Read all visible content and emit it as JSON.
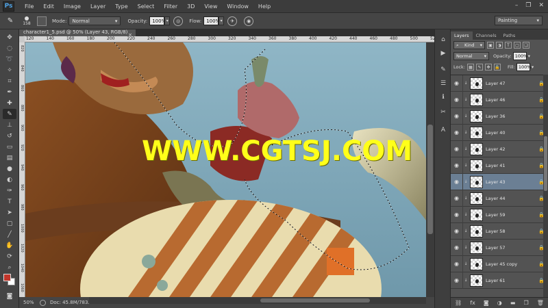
{
  "app": {
    "logo": "Ps",
    "menu": [
      "File",
      "Edit",
      "Image",
      "Layer",
      "Type",
      "Select",
      "Filter",
      "3D",
      "View",
      "Window",
      "Help"
    ],
    "window_controls": [
      "–",
      "❐",
      "✕"
    ]
  },
  "options_bar": {
    "brush_size": "158",
    "mode_label": "Mode:",
    "mode_value": "Normal",
    "opacity_label": "Opacity:",
    "opacity_value": "100%",
    "flow_label": "Flow:",
    "flow_value": "100%",
    "workspace": "Painting"
  },
  "document": {
    "tab_title": "character1_5.psd @ 50% (Layer 43, RGB/8) *",
    "close": "×"
  },
  "ruler_h_labels": [
    "120",
    "140",
    "160",
    "180",
    "200",
    "220",
    "240",
    "260",
    "280",
    "300",
    "320",
    "340",
    "360",
    "380",
    "400",
    "420",
    "440",
    "460",
    "480",
    "500",
    "520"
  ],
  "ruler_v_labels": [
    "820",
    "840",
    "860",
    "880",
    "900",
    "920",
    "940",
    "960",
    "980",
    "1000",
    "1020",
    "1040",
    "1060"
  ],
  "watermark": "WWW.CGTSJ.COM",
  "status": {
    "zoom": "50%",
    "doc": "Doc: 45.8M/783.6M"
  },
  "colors": {
    "foreground": "#c1352a",
    "background": "#ffffff",
    "watermark": "#ffff1a",
    "selected_layer": "#6b7f94"
  },
  "layers_panel": {
    "tabs": [
      "Layers",
      "Channels",
      "Paths"
    ],
    "kind": "Kind",
    "blend_mode": "Normal",
    "opacity_label": "Opacity:",
    "opacity_value": "100%",
    "lock_label": "Lock:",
    "fill_label": "Fill:",
    "fill_value": "100%",
    "layers": [
      {
        "name": "Layer 47",
        "selected": false
      },
      {
        "name": "Layer 46",
        "selected": false
      },
      {
        "name": "Layer 36",
        "selected": false
      },
      {
        "name": "Layer 40",
        "selected": false
      },
      {
        "name": "Layer 42",
        "selected": false
      },
      {
        "name": "Layer 41",
        "selected": false
      },
      {
        "name": "Layer 43",
        "selected": true
      },
      {
        "name": "Layer 44",
        "selected": false
      },
      {
        "name": "Layer 59",
        "selected": false
      },
      {
        "name": "Layer 58",
        "selected": false
      },
      {
        "name": "Layer 57",
        "selected": false
      },
      {
        "name": "Layer 45 copy",
        "selected": false
      },
      {
        "name": "Layer 61",
        "selected": false
      }
    ],
    "footer_icons": [
      "link-icon",
      "fx-icon",
      "mask-icon",
      "adjustment-icon",
      "group-icon",
      "new-layer-icon",
      "trash-icon"
    ]
  }
}
